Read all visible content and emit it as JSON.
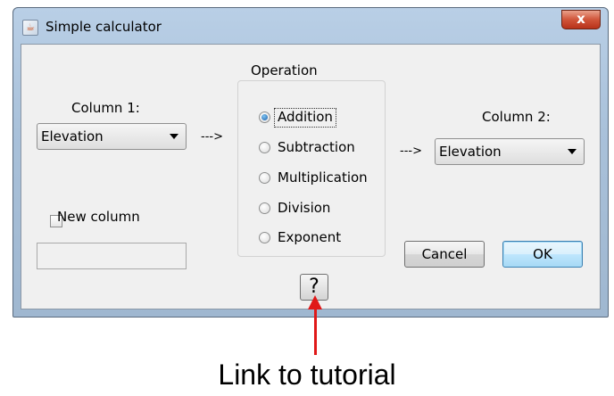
{
  "window": {
    "title": "Simple calculator",
    "close_glyph": "x"
  },
  "left": {
    "column1_label": "Column 1:",
    "column1_value": "Elevation",
    "arrow_text": "--->",
    "new_column_label": "New column",
    "new_column_checked": false,
    "new_column_input": ""
  },
  "operation": {
    "group_label": "Operation",
    "options": [
      "Addition",
      "Subtraction",
      "Multiplication",
      "Division",
      "Exponent"
    ],
    "selected": "Addition"
  },
  "right": {
    "arrow_text": "--->",
    "column2_label": "Column 2:",
    "column2_value": "Elevation"
  },
  "buttons": {
    "cancel": "Cancel",
    "ok": "OK",
    "help": "?"
  },
  "annotation": {
    "text": "Link to tutorial",
    "color": "#e01818"
  }
}
